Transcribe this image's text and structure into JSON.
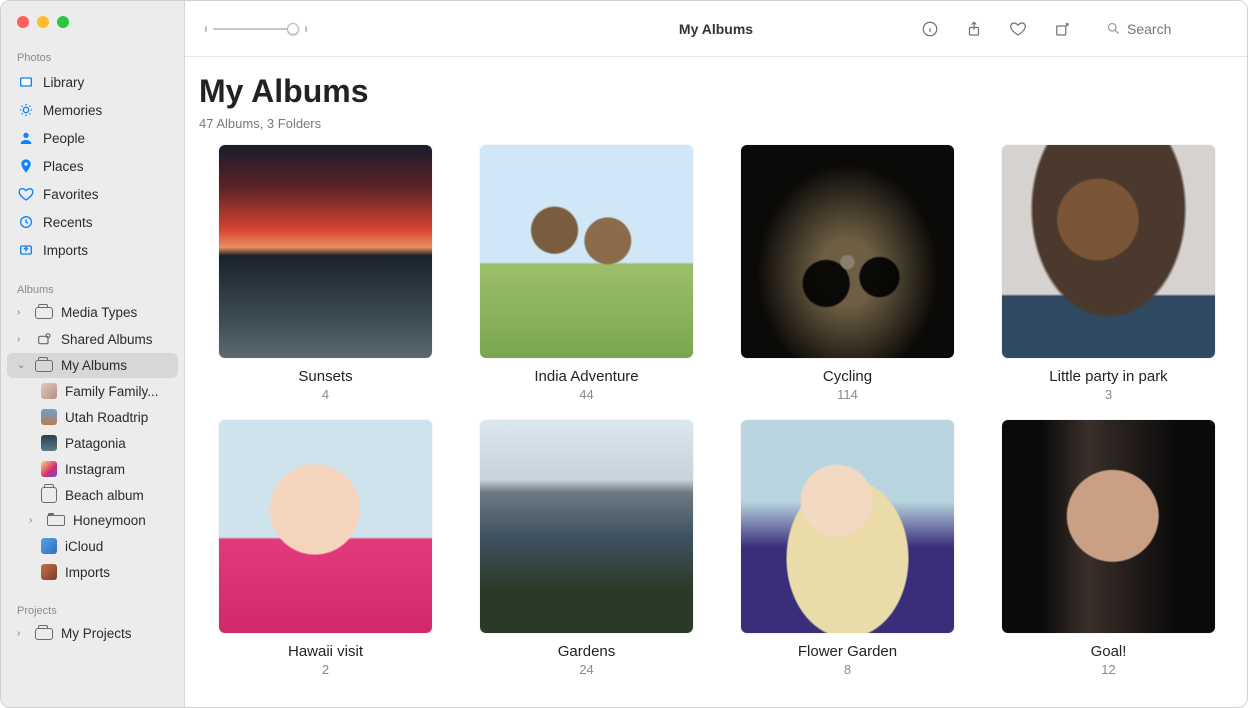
{
  "toolbar": {
    "title": "My Albums",
    "search_placeholder": "Search"
  },
  "sidebar": {
    "sections": {
      "photos": {
        "header": "Photos"
      },
      "albums": {
        "header": "Albums"
      },
      "projects": {
        "header": "Projects"
      }
    },
    "photos_items": [
      {
        "label": "Library"
      },
      {
        "label": "Memories"
      },
      {
        "label": "People"
      },
      {
        "label": "Places"
      },
      {
        "label": "Favorites"
      },
      {
        "label": "Recents"
      },
      {
        "label": "Imports"
      }
    ],
    "albums_items": [
      {
        "label": "Media Types",
        "chevron": "›"
      },
      {
        "label": "Shared Albums",
        "chevron": "›"
      },
      {
        "label": "My Albums",
        "chevron": "⌄",
        "selected": true
      }
    ],
    "my_albums_children": [
      {
        "label": "Family Family..."
      },
      {
        "label": "Utah Roadtrip"
      },
      {
        "label": "Patagonia"
      },
      {
        "label": "Instagram"
      },
      {
        "label": "Beach album"
      },
      {
        "label": "Honeymoon",
        "folder": true,
        "chevron": "›"
      },
      {
        "label": "iCloud"
      },
      {
        "label": "Imports"
      }
    ],
    "projects_items": [
      {
        "label": "My Projects",
        "chevron": "›"
      }
    ]
  },
  "page": {
    "heading": "My Albums",
    "subtitle": "47 Albums, 3 Folders"
  },
  "albums": [
    {
      "title": "Sunsets",
      "count": "4"
    },
    {
      "title": "India Adventure",
      "count": "44"
    },
    {
      "title": "Cycling",
      "count": "114"
    },
    {
      "title": "Little party in park",
      "count": "3"
    },
    {
      "title": "Hawaii visit",
      "count": "2"
    },
    {
      "title": "Gardens",
      "count": "24"
    },
    {
      "title": "Flower Garden",
      "count": "8"
    },
    {
      "title": "Goal!",
      "count": "12"
    }
  ]
}
